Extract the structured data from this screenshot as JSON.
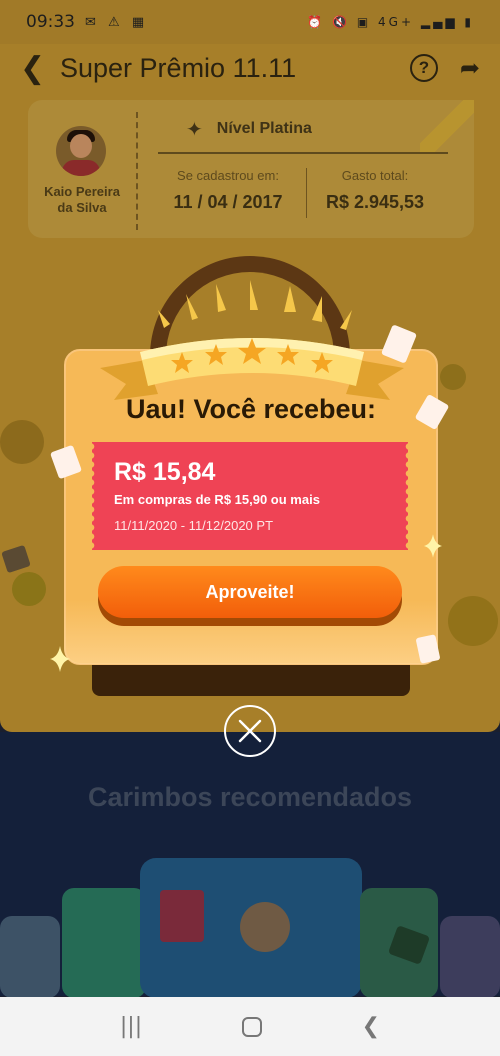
{
  "status_bar": {
    "time": "09:33",
    "left_icons": [
      "mail-icon",
      "alert-icon",
      "calendar-icon"
    ],
    "right_icons": [
      "alarm-icon",
      "mute-icon",
      "nfc-icon",
      "network-4g-icon",
      "signal-icon",
      "battery-icon"
    ],
    "network_label": "4G+"
  },
  "app_bar": {
    "title": "Super Prêmio 11.11",
    "help_label": "?"
  },
  "profile": {
    "name": "Kaio Pereira da Silva",
    "level": "Nível Platina",
    "registered_label": "Se cadastrou em:",
    "registered_value": "11 / 04 / 2017",
    "spent_label": "Gasto total:",
    "spent_value": "R$ 2.945,53"
  },
  "section": {
    "title": "Carimbos recomendados"
  },
  "modal": {
    "title": "Uau! Você recebeu:",
    "coupon": {
      "amount": "R$ 15,84",
      "condition": "Em compras de R$ 15,90 ou mais",
      "validity": "11/11/2020 - 11/12/2020 PT"
    },
    "cta_label": "Aproveite!"
  },
  "colors": {
    "modal_bg": "#f6b957",
    "coupon_bg": "#ef4355",
    "cta": "#f25e0a",
    "overlay_yellow": "#a77f29",
    "dark_section": "#14203a"
  }
}
